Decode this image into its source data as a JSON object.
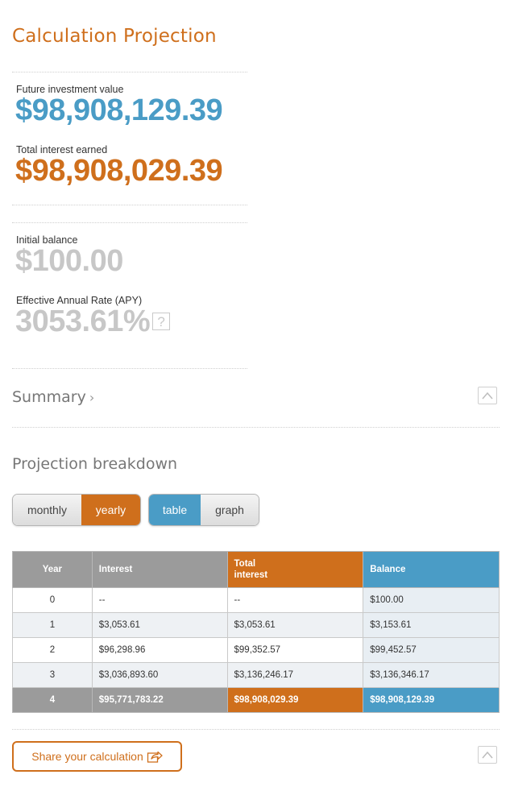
{
  "page": {
    "title": "Calculation Projection"
  },
  "results": {
    "future_value_label": "Future investment value",
    "future_value": "$98,908,129.39",
    "total_interest_label": "Total interest earned",
    "total_interest": "$98,908,029.39",
    "initial_balance_label": "Initial balance",
    "initial_balance": "$100.00",
    "apy_label": "Effective Annual Rate (APY)",
    "apy": "3053.61%",
    "apy_help": "?"
  },
  "summary": {
    "label": "Summary",
    "chevron": "›"
  },
  "breakdown": {
    "title": "Projection breakdown",
    "period_toggle": {
      "options": [
        "monthly",
        "yearly"
      ],
      "selected": "yearly"
    },
    "view_toggle": {
      "options": [
        "table",
        "graph"
      ],
      "selected": "table"
    }
  },
  "table": {
    "headers": [
      "Year",
      "Interest",
      "Total\ninterest",
      "Balance"
    ],
    "rows": [
      {
        "year": "0",
        "interest": "--",
        "total": "--",
        "balance": "$100.00"
      },
      {
        "year": "1",
        "interest": "$3,053.61",
        "total": "$3,053.61",
        "balance": "$3,153.61"
      },
      {
        "year": "2",
        "interest": "$96,298.96",
        "total": "$99,352.57",
        "balance": "$99,452.57"
      },
      {
        "year": "3",
        "interest": "$3,036,893.60",
        "total": "$3,136,246.17",
        "balance": "$3,136,346.17"
      },
      {
        "year": "4",
        "interest": "$95,771,783.22",
        "total": "$98,908,029.39",
        "balance": "$98,908,129.39"
      }
    ]
  },
  "share": {
    "label": "Share your calculation"
  },
  "colors": {
    "orange": "#cf6f1c",
    "blue": "#4a9cc6",
    "grey": "#9b9b9b"
  },
  "icons": {
    "help": "question-icon",
    "share": "share-arrow-icon",
    "collapse": "chevron-up-icon"
  }
}
